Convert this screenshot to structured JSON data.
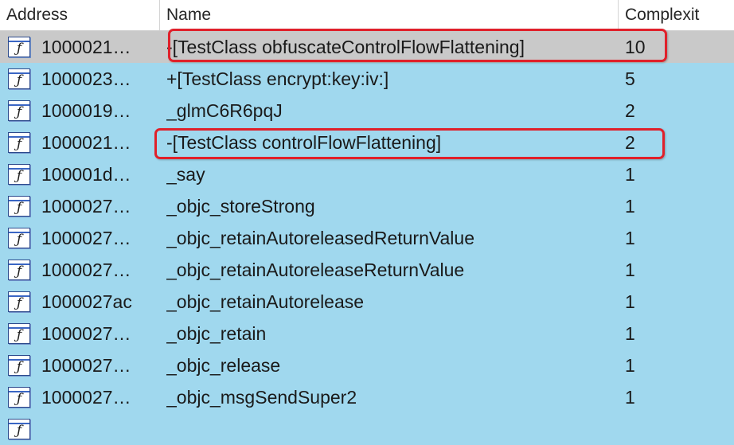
{
  "header": {
    "address_label": "Address",
    "name_label": "Name",
    "complexity_label": "Complexit"
  },
  "icon": {
    "glyph": "ƒ",
    "name": "function-icon"
  },
  "rows": [
    {
      "address": "1000021…",
      "name": "-[TestClass obfuscateControlFlowFlattening]",
      "complexity": "10",
      "selected": true,
      "highlighted": true
    },
    {
      "address": "1000023…",
      "name": "+[TestClass encrypt:key:iv:]",
      "complexity": "5"
    },
    {
      "address": "1000019…",
      "name": "_glmC6R6pqJ",
      "complexity": "2"
    },
    {
      "address": "1000021…",
      "name": "-[TestClass controlFlowFlattening]",
      "complexity": "2",
      "highlighted": true
    },
    {
      "address": "100001d…",
      "name": "_say",
      "complexity": "1"
    },
    {
      "address": "1000027…",
      "name": "_objc_storeStrong",
      "complexity": "1"
    },
    {
      "address": "1000027…",
      "name": "_objc_retainAutoreleasedReturnValue",
      "complexity": "1"
    },
    {
      "address": "1000027…",
      "name": "_objc_retainAutoreleaseReturnValue",
      "complexity": "1"
    },
    {
      "address": "1000027ac",
      "name": "_objc_retainAutorelease",
      "complexity": "1"
    },
    {
      "address": "1000027…",
      "name": "_objc_retain",
      "complexity": "1"
    },
    {
      "address": "1000027…",
      "name": "_objc_release",
      "complexity": "1"
    },
    {
      "address": "1000027…",
      "name": "_objc_msgSendSuper2",
      "complexity": "1"
    }
  ],
  "colors": {
    "row_background": "#a0d8ee",
    "selected_background": "#c9c9c9",
    "highlight_border": "#e0202a"
  }
}
